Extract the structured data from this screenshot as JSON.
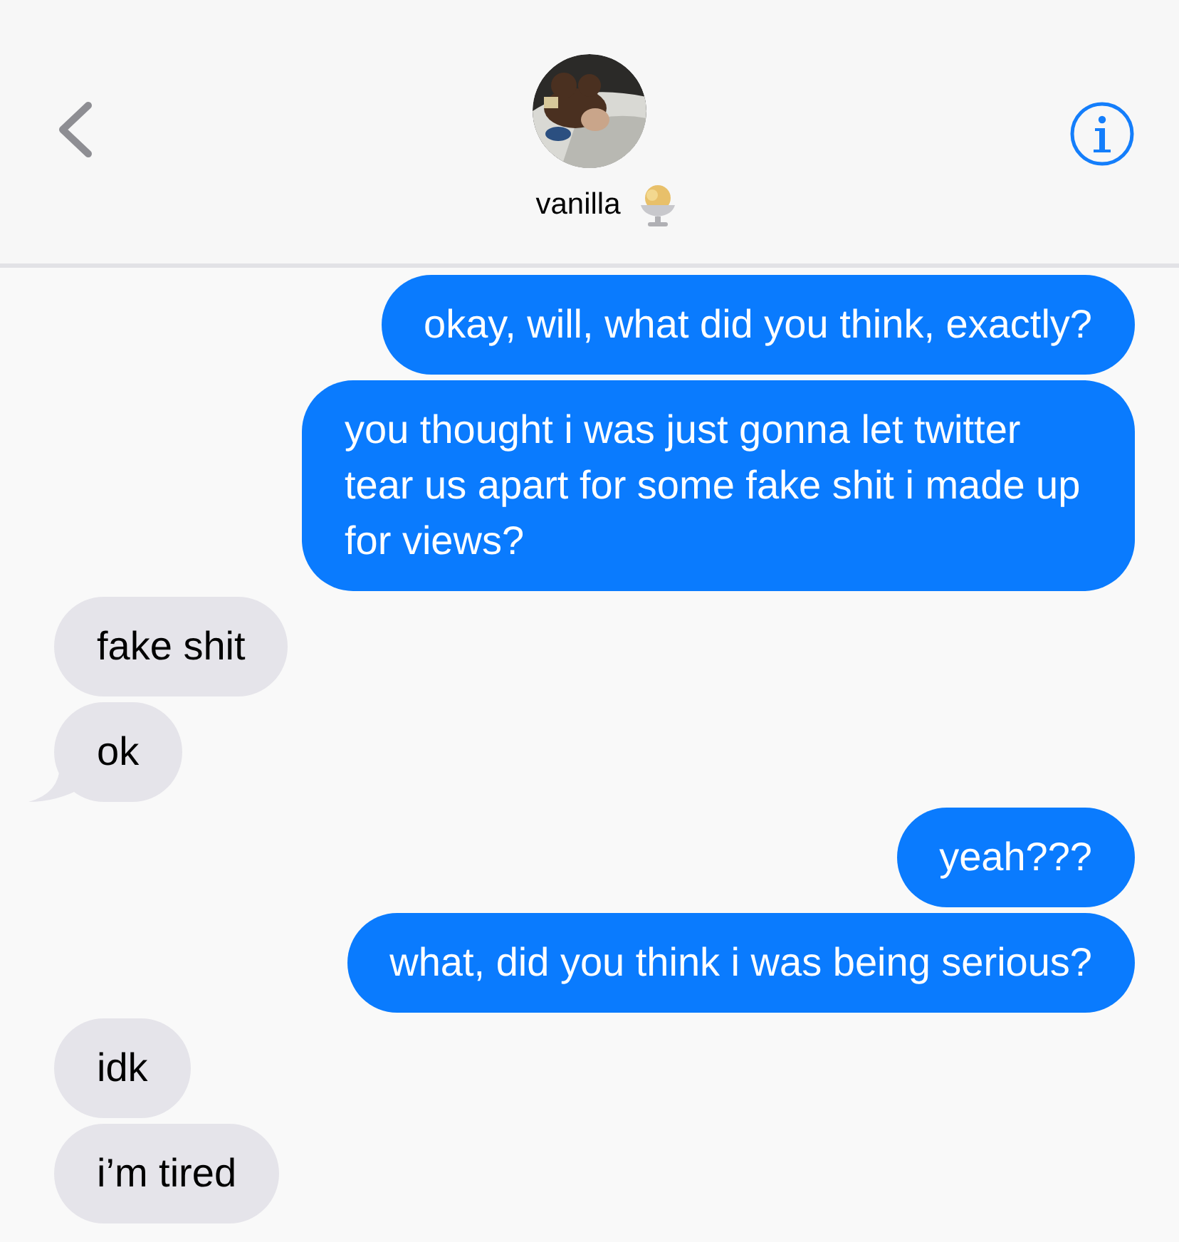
{
  "contact": {
    "name": "vanilla"
  },
  "messages": [
    {
      "kind": "sent",
      "text": "okay, will, what did you think, exactly?",
      "tail": false
    },
    {
      "kind": "sent",
      "text": "you thought i was just gonna let twitter tear us apart for some fake shit i made up for views?",
      "tail": false
    },
    {
      "kind": "received",
      "text": "fake shit",
      "tail": false
    },
    {
      "kind": "received",
      "text": "ok",
      "tail": true
    },
    {
      "kind": "sent",
      "text": "yeah???",
      "tail": false
    },
    {
      "kind": "sent",
      "text": "what, did you think i was being serious?",
      "tail": false
    },
    {
      "kind": "received",
      "text": "idk",
      "tail": false
    },
    {
      "kind": "received",
      "text": "i’m tired",
      "tail": false
    }
  ]
}
